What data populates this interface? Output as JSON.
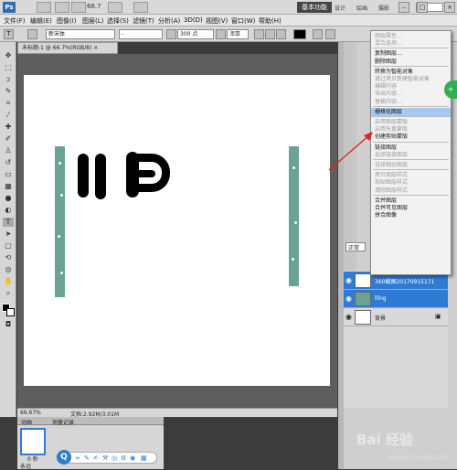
{
  "titlebar": {
    "logo": "Ps",
    "zoom": "66.7",
    "workspace": "基本功能",
    "workspace_options": [
      "设计",
      "绘画",
      "摄影"
    ],
    "window_controls": [
      "–",
      "□",
      "×"
    ]
  },
  "menubar": {
    "items": [
      "文件(F)",
      "编辑(E)",
      "图像(I)",
      "图层(L)",
      "选择(S)",
      "滤镜(T)",
      "分析(A)",
      "3D(D)",
      "视图(V)",
      "窗口(W)",
      "帮助(H)"
    ]
  },
  "options": {
    "tool_icon": "T",
    "font_family": "新宋体",
    "font_style": "-",
    "font_size": "300 点",
    "antialias": "浑厚"
  },
  "document": {
    "tab_title": "未标题-1 @ 66.7%(RGB/8)",
    "tab_close": "×",
    "status_zoom": "66.67%",
    "status_doc": "文档:2.92M/3.01M"
  },
  "bottom_panel": {
    "tabs": [
      "动画",
      "测量记录"
    ],
    "frame_delay": "0 秒",
    "loop": "永远",
    "blue_ball": "Q"
  },
  "layers": {
    "rows": [
      {
        "name": "360截图20170915171",
        "selected": true
      },
      {
        "name": "lllng",
        "selected": true
      },
      {
        "name": "背景",
        "selected": false
      }
    ],
    "blend_mode": "正常"
  },
  "context_menu": {
    "items": [
      {
        "label": "图层属性...",
        "disabled": true
      },
      {
        "label": "混合选项...",
        "disabled": true
      },
      {
        "sep": true
      },
      {
        "label": "复制图层...",
        "disabled": false
      },
      {
        "label": "删除图层",
        "disabled": false
      },
      {
        "sep": true
      },
      {
        "label": "转换为智能对象",
        "disabled": false
      },
      {
        "label": "通过拷贝新建智能对象",
        "disabled": true
      },
      {
        "label": "编辑内容",
        "disabled": true
      },
      {
        "label": "导出内容...",
        "disabled": true
      },
      {
        "label": "替换内容...",
        "disabled": true
      },
      {
        "sep": true
      },
      {
        "label": "栅格化图层",
        "disabled": false,
        "highlight": true
      },
      {
        "sep": true
      },
      {
        "label": "启用图层蒙版",
        "disabled": true
      },
      {
        "label": "启用矢量蒙版",
        "disabled": true
      },
      {
        "label": "创建剪贴蒙版",
        "disabled": false
      },
      {
        "sep": true
      },
      {
        "label": "链接图层",
        "disabled": false
      },
      {
        "label": "选择链接图层",
        "disabled": true
      },
      {
        "sep": true
      },
      {
        "label": "选择相似图层",
        "disabled": true
      },
      {
        "sep": true
      },
      {
        "label": "拷贝图层样式",
        "disabled": true
      },
      {
        "label": "粘贴图层样式",
        "disabled": true
      },
      {
        "label": "清除图层样式",
        "disabled": true
      },
      {
        "sep": true
      },
      {
        "label": "合并图层",
        "disabled": false
      },
      {
        "label": "合并可见图层",
        "disabled": false
      },
      {
        "label": "拼合图像",
        "disabled": false
      }
    ]
  },
  "watermark": {
    "brand": "Bai 经验",
    "url": "jingyan.baidu.com"
  },
  "green_button": "+"
}
